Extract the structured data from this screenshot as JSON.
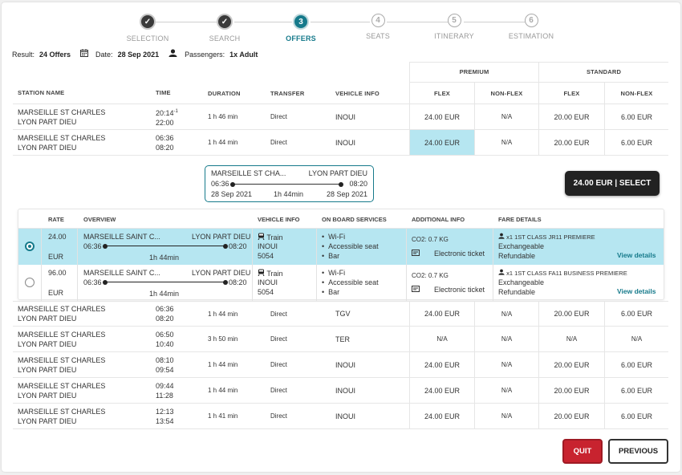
{
  "stepper": [
    {
      "label": "SELECTION",
      "num": "✓",
      "state": "done"
    },
    {
      "label": "SEARCH",
      "num": "✓",
      "state": "done"
    },
    {
      "label": "OFFERS",
      "num": "3",
      "state": "active"
    },
    {
      "label": "SEATS",
      "num": "4",
      "state": "todo"
    },
    {
      "label": "ITINERARY",
      "num": "5",
      "state": "todo"
    },
    {
      "label": "ESTIMATION",
      "num": "6",
      "state": "todo"
    }
  ],
  "summary": {
    "result_label": "Result:",
    "result_value": "24 Offers",
    "date_label": "Date:",
    "date_value": "28 Sep 2021",
    "pass_label": "Passengers:",
    "pass_value": "1x Adult"
  },
  "table": {
    "group_premium": "PREMIUM",
    "group_standard": "STANDARD",
    "headers": {
      "station": "STATION NAME",
      "time": "TIME",
      "duration": "DURATION",
      "transfer": "TRANSFER",
      "vehicle": "VEHICLE INFO",
      "flex1": "FLEX",
      "nonflex1": "NON-FLEX",
      "flex2": "FLEX",
      "nonflex2": "NON-FLEX"
    },
    "rows": [
      {
        "from": "MARSEILLE ST CHARLES",
        "to": "LYON PART DIEU",
        "dep": "20:14",
        "dep_sup": "-1",
        "arr": "22:00",
        "duration": "1 h 46 min",
        "transfer": "Direct",
        "vehicle": "INOUI",
        "p1": "24.00 EUR",
        "p2": "N/A",
        "p3": "20.00 EUR",
        "p4": "6.00 EUR"
      },
      {
        "from": "MARSEILLE ST CHARLES",
        "to": "LYON PART DIEU",
        "dep": "06:36",
        "dep_sup": "",
        "arr": "08:20",
        "duration": "1 h 44 min",
        "transfer": "Direct",
        "vehicle": "INOUI",
        "p1": "24.00 EUR",
        "p2": "N/A",
        "p3": "20.00 EUR",
        "p4": "6.00 EUR"
      },
      {
        "from": "MARSEILLE ST CHARLES",
        "to": "LYON PART DIEU",
        "dep": "06:36",
        "dep_sup": "",
        "arr": "08:20",
        "duration": "1 h 44 min",
        "transfer": "Direct",
        "vehicle": "TGV",
        "p1": "24.00 EUR",
        "p2": "N/A",
        "p3": "20.00 EUR",
        "p4": "6.00 EUR"
      },
      {
        "from": "MARSEILLE ST CHARLES",
        "to": "LYON PART DIEU",
        "dep": "06:50",
        "dep_sup": "",
        "arr": "10:40",
        "duration": "3 h 50 min",
        "transfer": "Direct",
        "vehicle": "TER",
        "p1": "N/A",
        "p2": "N/A",
        "p3": "N/A",
        "p4": "N/A"
      },
      {
        "from": "MARSEILLE ST CHARLES",
        "to": "LYON PART DIEU",
        "dep": "08:10",
        "dep_sup": "",
        "arr": "09:54",
        "duration": "1 h 44 min",
        "transfer": "Direct",
        "vehicle": "INOUI",
        "p1": "24.00 EUR",
        "p2": "N/A",
        "p3": "20.00 EUR",
        "p4": "6.00 EUR"
      },
      {
        "from": "MARSEILLE ST CHARLES",
        "to": "LYON PART DIEU",
        "dep": "09:44",
        "dep_sup": "",
        "arr": "11:28",
        "duration": "1 h 44 min",
        "transfer": "Direct",
        "vehicle": "INOUI",
        "p1": "24.00 EUR",
        "p2": "N/A",
        "p3": "20.00 EUR",
        "p4": "6.00 EUR"
      },
      {
        "from": "MARSEILLE ST CHARLES",
        "to": "LYON PART DIEU",
        "dep": "12:13",
        "dep_sup": "",
        "arr": "13:54",
        "duration": "1 h 41 min",
        "transfer": "Direct",
        "vehicle": "INOUI",
        "p1": "24.00 EUR",
        "p2": "N/A",
        "p3": "20.00 EUR",
        "p4": "6.00 EUR"
      }
    ]
  },
  "detail": {
    "journey": {
      "from": "MARSEILLE ST CHA...",
      "to": "LYON PART DIEU",
      "dep": "06:36",
      "arr": "08:20",
      "dep_date": "28 Sep 2021",
      "arr_date": "28 Sep 2021",
      "duration": "1h 44min"
    },
    "select_label": "24.00 EUR | SELECT",
    "headers": {
      "rate": "RATE",
      "overview": "OVERVIEW",
      "vehicle": "VEHICLE INFO",
      "services": "ON BOARD SERVICES",
      "additional": "ADDITIONAL INFO",
      "fare": "FARE DETAILS"
    },
    "fares": [
      {
        "rate": "24.00",
        "currency": "EUR",
        "from": "MARSEILLE SAINT C...",
        "to": "LYON PART DIEU",
        "dep": "06:36",
        "arr": "08:20",
        "duration": "1h 44min",
        "vehicle_type": "Train",
        "vehicle_name": "INOUI",
        "vehicle_num": "5054",
        "services": [
          "Wi-Fi",
          "Accessible seat",
          "Bar"
        ],
        "co2": "CO2: 0.7 KG",
        "ticket": "Electronic ticket",
        "fare_class": "x1 1ST CLASS JR11 PREMIERE",
        "cond1": "Exchangeable",
        "cond2": "Refundable",
        "view": "View details",
        "selected": true
      },
      {
        "rate": "96.00",
        "currency": "EUR",
        "from": "MARSEILLE SAINT C...",
        "to": "LYON PART DIEU",
        "dep": "06:36",
        "arr": "08:20",
        "duration": "1h 44min",
        "vehicle_type": "Train",
        "vehicle_name": "INOUI",
        "vehicle_num": "5054",
        "services": [
          "Wi-Fi",
          "Accessible seat",
          "Bar"
        ],
        "co2": "CO2: 0.7 KG",
        "ticket": "Electronic ticket",
        "fare_class": "x1 1ST CLASS FA11 BUSINESS PREMIERE",
        "cond1": "Exchangeable",
        "cond2": "Refundable",
        "view": "View details",
        "selected": false
      }
    ]
  },
  "buttons": {
    "quit": "QUIT",
    "previous": "PREVIOUS"
  },
  "colors": {
    "accent": "#167a8b",
    "selected_bg": "#b6e6f1",
    "quit_bg": "#c8232f"
  }
}
